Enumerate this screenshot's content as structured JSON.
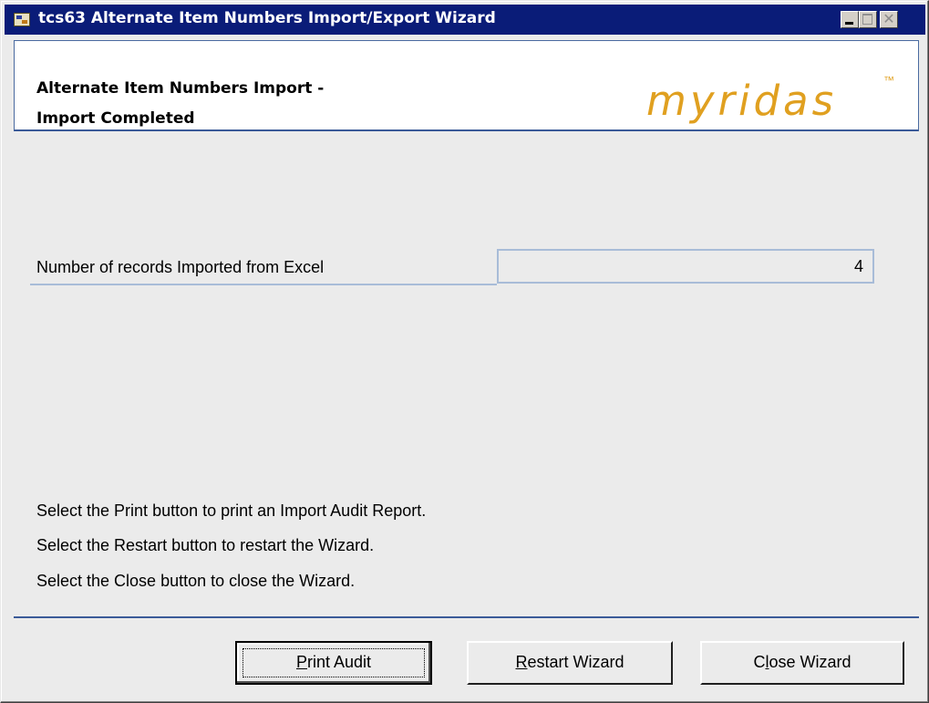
{
  "window": {
    "title": "tcs63 Alternate Item Numbers Import/Export Wizard",
    "controls": {
      "minimize": "minimize-icon",
      "maximize": "maximize-icon",
      "close": "close-icon"
    }
  },
  "header": {
    "title_line1": "Alternate Item Numbers Import -",
    "title_line2": "Import Completed",
    "logo": "myridas",
    "logo_tm": "™",
    "logo_color": "#e0a020"
  },
  "field": {
    "label": "Number of records Imported from Excel",
    "value": "4"
  },
  "instructions": [
    "Select the Print button to print an Import Audit Report.",
    "Select the Restart button to restart the Wizard.",
    "Select the Close button to close the Wizard."
  ],
  "buttons": {
    "print": {
      "first": "P",
      "rest": "rint Audit"
    },
    "restart": {
      "first": "R",
      "rest": "estart Wizard"
    },
    "close": {
      "pre": "C",
      "mid": "l",
      "rest": "ose Wizard"
    }
  },
  "colors": {
    "titlebar": "#0a1c78",
    "accent_border": "#3a5a98",
    "field_border": "#a8bcd8"
  }
}
